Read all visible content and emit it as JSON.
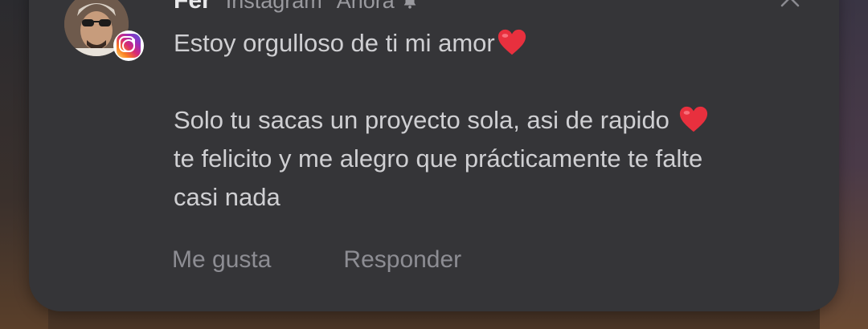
{
  "notification": {
    "sender": "Fer",
    "app": "Instagram",
    "time": "Ahora",
    "app_icon": "instagram-icon",
    "silent_icon": "bell-icon",
    "message": {
      "line1": "Estoy orgulloso de ti mi amor",
      "line3": "Solo tu sacas un proyecto sola, asi de rapido",
      "line4": "te felicito y me alegro que prácticamente te falte",
      "line5": "casi nada"
    },
    "actions": {
      "like": "Me gusta",
      "reply": "Responder"
    }
  },
  "colors": {
    "card": "#353538",
    "message_text": "#cfcfd2",
    "action_text": "#8d8d93",
    "heart": "#e8303e"
  }
}
